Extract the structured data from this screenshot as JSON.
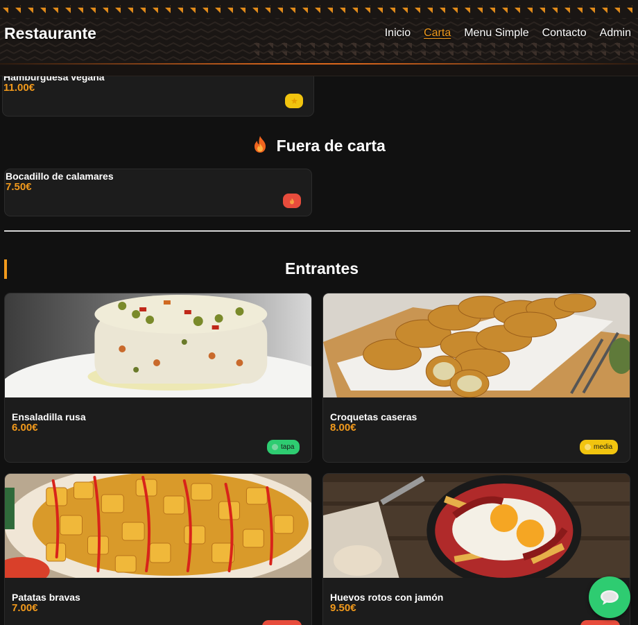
{
  "header": {
    "brand": "Restaurante",
    "nav": [
      {
        "label": "Inicio",
        "active": false
      },
      {
        "label": "Carta",
        "active": true
      },
      {
        "label": "Menu Simple",
        "active": false
      },
      {
        "label": "Contacto",
        "active": false
      },
      {
        "label": "Admin",
        "active": false
      }
    ]
  },
  "partial_card": {
    "name": "Hamburguesa vegana",
    "price": "11.00€",
    "badge_icon": "star-icon",
    "badge_color": "#f1c40f"
  },
  "fuera_de_carta": {
    "title": "Fuera de carta",
    "icon": "flame-icon",
    "items": [
      {
        "name": "Bocadillo de calamares",
        "price": "7.50€",
        "badge_icon": "flame-icon",
        "badge_color": "#e74c3c"
      }
    ]
  },
  "entrantes": {
    "title": "Entrantes",
    "items": [
      {
        "name": "Ensaladilla rusa",
        "price": "6.00€",
        "badge": "tapa",
        "badge_color": "#2ecc71",
        "photo": "ensaladilla-photo"
      },
      {
        "name": "Croquetas caseras",
        "price": "8.00€",
        "badge": "media",
        "badge_color": "#f1c40f",
        "photo": "croquetas-photo"
      },
      {
        "name": "Patatas bravas",
        "price": "7.00€",
        "badge_color": "#e74c3c",
        "photo": "patatas-photo"
      },
      {
        "name": "Huevos rotos con jamón",
        "price": "9.50€",
        "badge_color": "#e74c3c",
        "photo": "huevos-photo"
      }
    ]
  },
  "chat_button": {
    "icon": "chat-bubble-icon",
    "color": "#2ecc71"
  }
}
